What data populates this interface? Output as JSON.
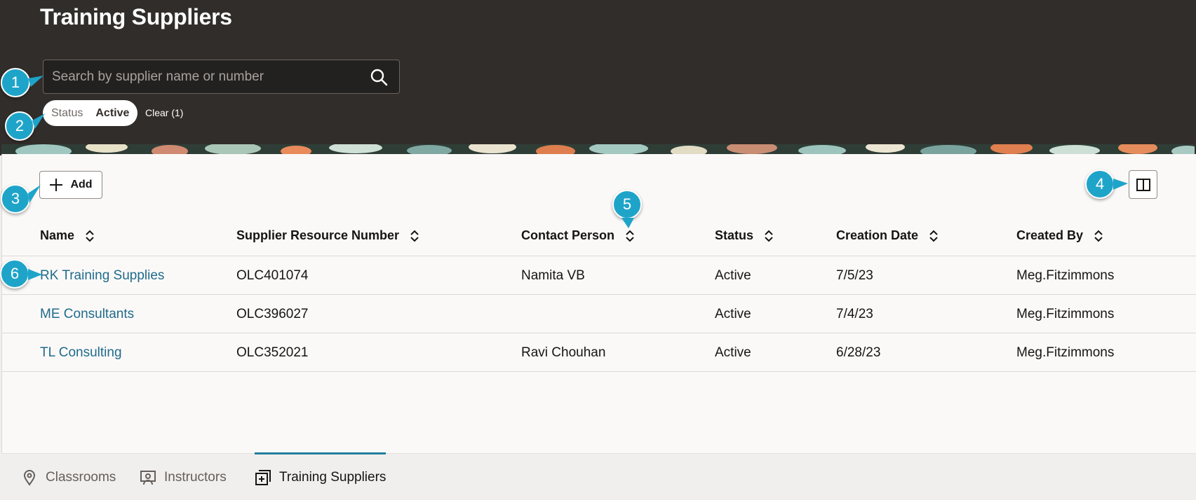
{
  "page": {
    "title": "Training Suppliers"
  },
  "search": {
    "placeholder": "Search by supplier name or number",
    "value": ""
  },
  "filter": {
    "label": "Status",
    "value": "Active",
    "clear_label": "Clear (1)"
  },
  "toolbar": {
    "add_label": "Add"
  },
  "table": {
    "columns": [
      "Name",
      "Supplier Resource Number",
      "Contact Person",
      "Status",
      "Creation Date",
      "Created By"
    ],
    "rows": [
      {
        "name": "RK Training Supplies",
        "number": "OLC401074",
        "contact": "Namita VB",
        "status": "Active",
        "created": "7/5/23",
        "created_by": "Meg.Fitzimmons"
      },
      {
        "name": "ME Consultants",
        "number": "OLC396027",
        "contact": "",
        "status": "Active",
        "created": "7/4/23",
        "created_by": "Meg.Fitzimmons"
      },
      {
        "name": "TL Consulting",
        "number": "OLC352021",
        "contact": "Ravi Chouhan",
        "status": "Active",
        "created": "6/28/23",
        "created_by": "Meg.Fitzimmons"
      }
    ]
  },
  "tabs": [
    {
      "label": "Classrooms",
      "icon": "location-pin-icon",
      "active": false
    },
    {
      "label": "Instructors",
      "icon": "instructor-icon",
      "active": false
    },
    {
      "label": "Training Suppliers",
      "icon": "supplier-icon",
      "active": true
    }
  ],
  "callouts": [
    "1",
    "2",
    "3",
    "4",
    "5",
    "6"
  ],
  "colors": {
    "header_bg": "#312d2a",
    "link": "#1f6b8b",
    "callout": "#1fa4c9",
    "tab_indicator": "#227e9e"
  }
}
